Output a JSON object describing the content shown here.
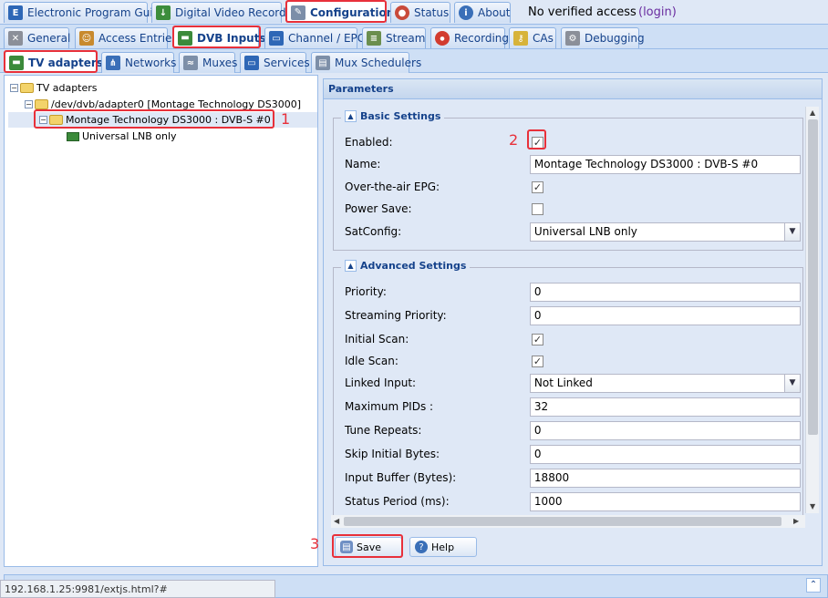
{
  "top_tabs": [
    {
      "label": "Electronic Program Guide",
      "icon": "epg-icon",
      "active": false
    },
    {
      "label": "Digital Video Recorder",
      "icon": "download-icon",
      "active": false
    },
    {
      "label": "Configuration",
      "icon": "wrench-icon",
      "active": true
    },
    {
      "label": "Status",
      "icon": "eye-icon",
      "active": false
    },
    {
      "label": "About",
      "icon": "info-icon",
      "active": false
    }
  ],
  "access": {
    "text": "No verified access",
    "login": "(login)"
  },
  "config_tabs": [
    {
      "label": "General",
      "icon": "tools-icon"
    },
    {
      "label": "Access Entries",
      "icon": "users-icon"
    },
    {
      "label": "DVB Inputs",
      "icon": "dvb-icon",
      "active": true
    },
    {
      "label": "Channel / EPG",
      "icon": "tv-icon"
    },
    {
      "label": "Stream",
      "icon": "stream-icon"
    },
    {
      "label": "Recording",
      "icon": "rec-icon"
    },
    {
      "label": "CAs",
      "icon": "key-icon"
    },
    {
      "label": "Debugging",
      "icon": "gears-icon"
    }
  ],
  "dvb_tabs": [
    {
      "label": "TV adapters",
      "icon": "adapter-icon",
      "active": true
    },
    {
      "label": "Networks",
      "icon": "antenna-icon"
    },
    {
      "label": "Muxes",
      "icon": "mux-icon"
    },
    {
      "label": "Services",
      "icon": "services-icon"
    },
    {
      "label": "Mux Schedulers",
      "icon": "scheduler-icon"
    }
  ],
  "tree": {
    "root": "TV adapters",
    "adapter": "/dev/dvb/adapter0 [Montage Technology DS3000]",
    "frontend": "Montage Technology DS3000 : DVB-S #0",
    "lnb": "Universal LNB only"
  },
  "annotations": {
    "one": "1",
    "two": "2",
    "three": "3"
  },
  "params": {
    "title": "Parameters",
    "basic": {
      "legend": "Basic Settings",
      "enabled_label": "Enabled:",
      "enabled": true,
      "name_label": "Name:",
      "name_value": "Montage Technology DS3000 : DVB-S #0",
      "ota_label": "Over-the-air EPG:",
      "ota": true,
      "power_label": "Power Save:",
      "power": false,
      "sat_label": "SatConfig:",
      "sat_value": "Universal LNB only"
    },
    "advanced": {
      "legend": "Advanced Settings",
      "priority_label": "Priority:",
      "priority_value": "0",
      "stream_priority_label": "Streaming Priority:",
      "stream_priority_value": "0",
      "initial_scan_label": "Initial Scan:",
      "initial_scan": true,
      "idle_scan_label": "Idle Scan:",
      "idle_scan": true,
      "linked_label": "Linked Input:",
      "linked_value": "Not Linked",
      "max_pids_label": "Maximum PIDs :",
      "max_pids_value": "32",
      "tune_label": "Tune Repeats:",
      "tune_value": "0",
      "skip_label": "Skip Initial Bytes:",
      "skip_value": "0",
      "buffer_label": "Input Buffer (Bytes):",
      "buffer_value": "18800",
      "status_label": "Status Period (ms):",
      "status_value": "1000"
    }
  },
  "buttons": {
    "save": "Save",
    "help": "Help"
  },
  "status_url": "192.168.1.25:9981/extjs.html?#",
  "colors": {
    "accent": "#15428b",
    "annotation": "#e8303a"
  }
}
